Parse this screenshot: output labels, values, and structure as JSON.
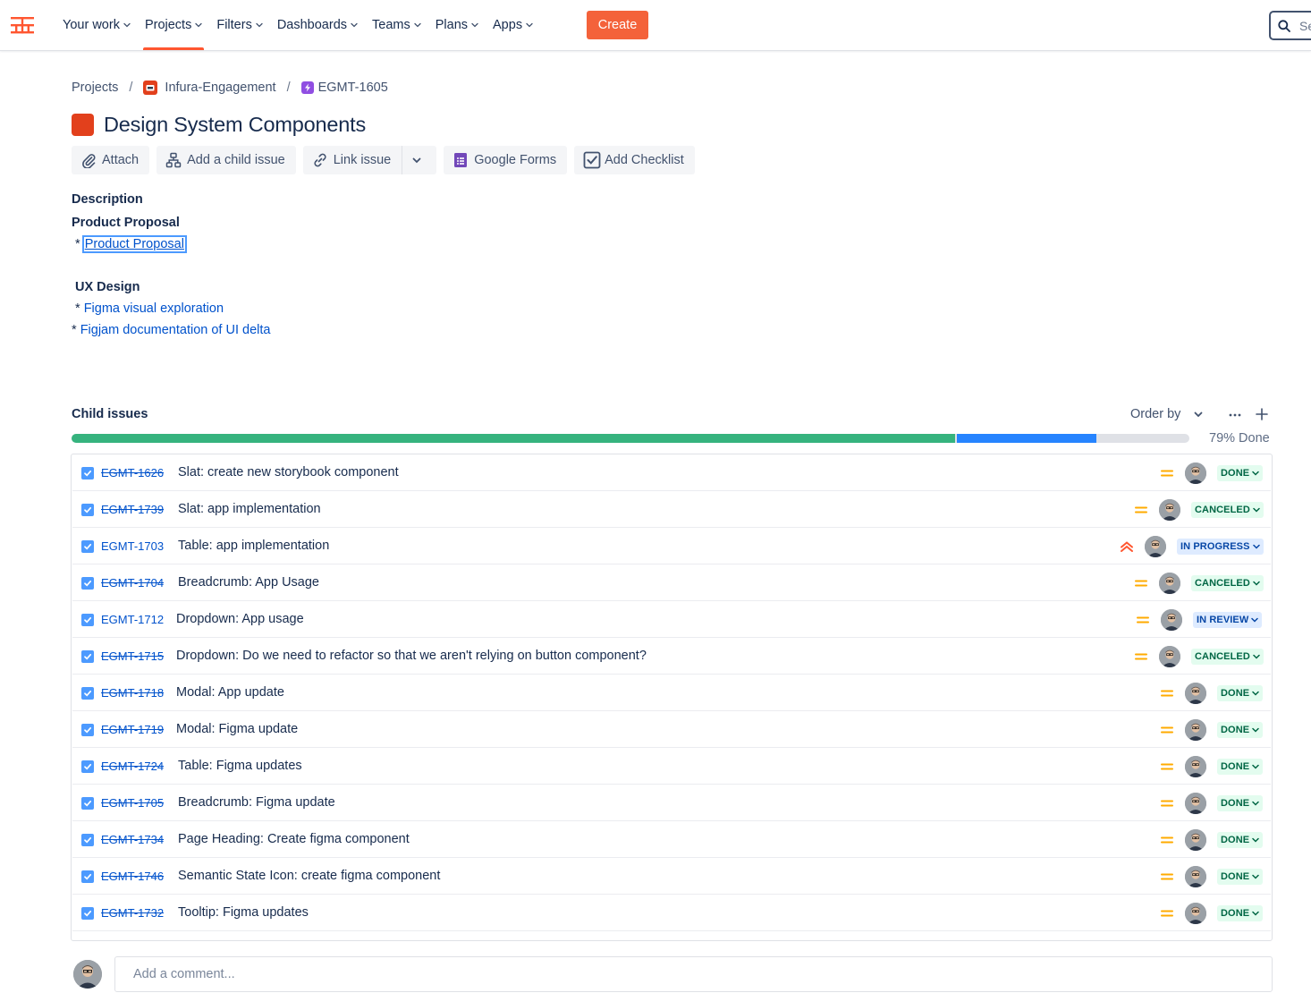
{
  "nav": {
    "items": [
      {
        "label": "Your work",
        "active": false
      },
      {
        "label": "Projects",
        "active": true
      },
      {
        "label": "Filters",
        "active": false
      },
      {
        "label": "Dashboards",
        "active": false
      },
      {
        "label": "Teams",
        "active": false
      },
      {
        "label": "Plans",
        "active": false
      },
      {
        "label": "Apps",
        "active": false
      }
    ],
    "create_label": "Create",
    "search_placeholder": "Se",
    "accent": "#ff5630"
  },
  "breadcrumb": {
    "root": "Projects",
    "project": "Infura-Engagement",
    "issue": "EGMT-1605"
  },
  "issue": {
    "title": "Design System Components",
    "type_color": "#e2401c"
  },
  "toolbar": {
    "attach": "Attach",
    "add_child": "Add a child issue",
    "link_issue": "Link issue",
    "google_forms": "Google Forms",
    "add_checklist": "Add Checklist"
  },
  "description": {
    "label": "Description",
    "section1_heading": "Product Proposal",
    "section1_link": "Product Proposal",
    "section2_heading": "UX Design",
    "section2_link1": "Figma visual exploration",
    "section2_link2": "Figjam documentation of UI delta",
    "bullet": "*"
  },
  "child_issues": {
    "header": "Child issues",
    "order_by": "Order by",
    "progress_label": "79% Done",
    "progress_done_fraction": 0.79,
    "progress_in_progress_fraction": 0.125,
    "rows": [
      {
        "key": "EGMT-1626",
        "summary": "Slat: create new storybook component",
        "strike": true,
        "priority": "medium",
        "status": "DONE",
        "status_color": "green"
      },
      {
        "key": "EGMT-1739",
        "summary": "Slat: app implementation",
        "strike": true,
        "priority": "medium",
        "status": "CANCELED",
        "status_color": "green"
      },
      {
        "key": "EGMT-1703",
        "summary": "Table: app implementation",
        "strike": false,
        "priority": "highest",
        "status": "IN PROGRESS",
        "status_color": "blue"
      },
      {
        "key": "EGMT-1704",
        "summary": "Breadcrumb: App Usage",
        "strike": true,
        "priority": "medium",
        "status": "CANCELED",
        "status_color": "green"
      },
      {
        "key": "EGMT-1712",
        "summary": "Dropdown: App usage",
        "strike": false,
        "priority": "medium",
        "status": "IN REVIEW",
        "status_color": "blue"
      },
      {
        "key": "EGMT-1715",
        "summary": "Dropdown: Do we need to refactor so that we aren't relying on button component?",
        "strike": true,
        "priority": "medium",
        "status": "CANCELED",
        "status_color": "green"
      },
      {
        "key": "EGMT-1718",
        "summary": "Modal: App update",
        "strike": true,
        "priority": "medium",
        "status": "DONE",
        "status_color": "green"
      },
      {
        "key": "EGMT-1719",
        "summary": "Modal: Figma update",
        "strike": true,
        "priority": "medium",
        "status": "DONE",
        "status_color": "green"
      },
      {
        "key": "EGMT-1724",
        "summary": "Table: Figma updates",
        "strike": true,
        "priority": "medium",
        "status": "DONE",
        "status_color": "green"
      },
      {
        "key": "EGMT-1705",
        "summary": "Breadcrumb: Figma update",
        "strike": true,
        "priority": "medium",
        "status": "DONE",
        "status_color": "green"
      },
      {
        "key": "EGMT-1734",
        "summary": "Page Heading: Create figma component",
        "strike": true,
        "priority": "medium",
        "status": "DONE",
        "status_color": "green"
      },
      {
        "key": "EGMT-1746",
        "summary": "Semantic State Icon: create figma component",
        "strike": true,
        "priority": "medium",
        "status": "DONE",
        "status_color": "green"
      },
      {
        "key": "EGMT-1732",
        "summary": "Tooltip: Figma updates",
        "strike": true,
        "priority": "medium",
        "status": "DONE",
        "status_color": "green"
      }
    ]
  },
  "comment": {
    "placeholder": "Add a comment..."
  }
}
